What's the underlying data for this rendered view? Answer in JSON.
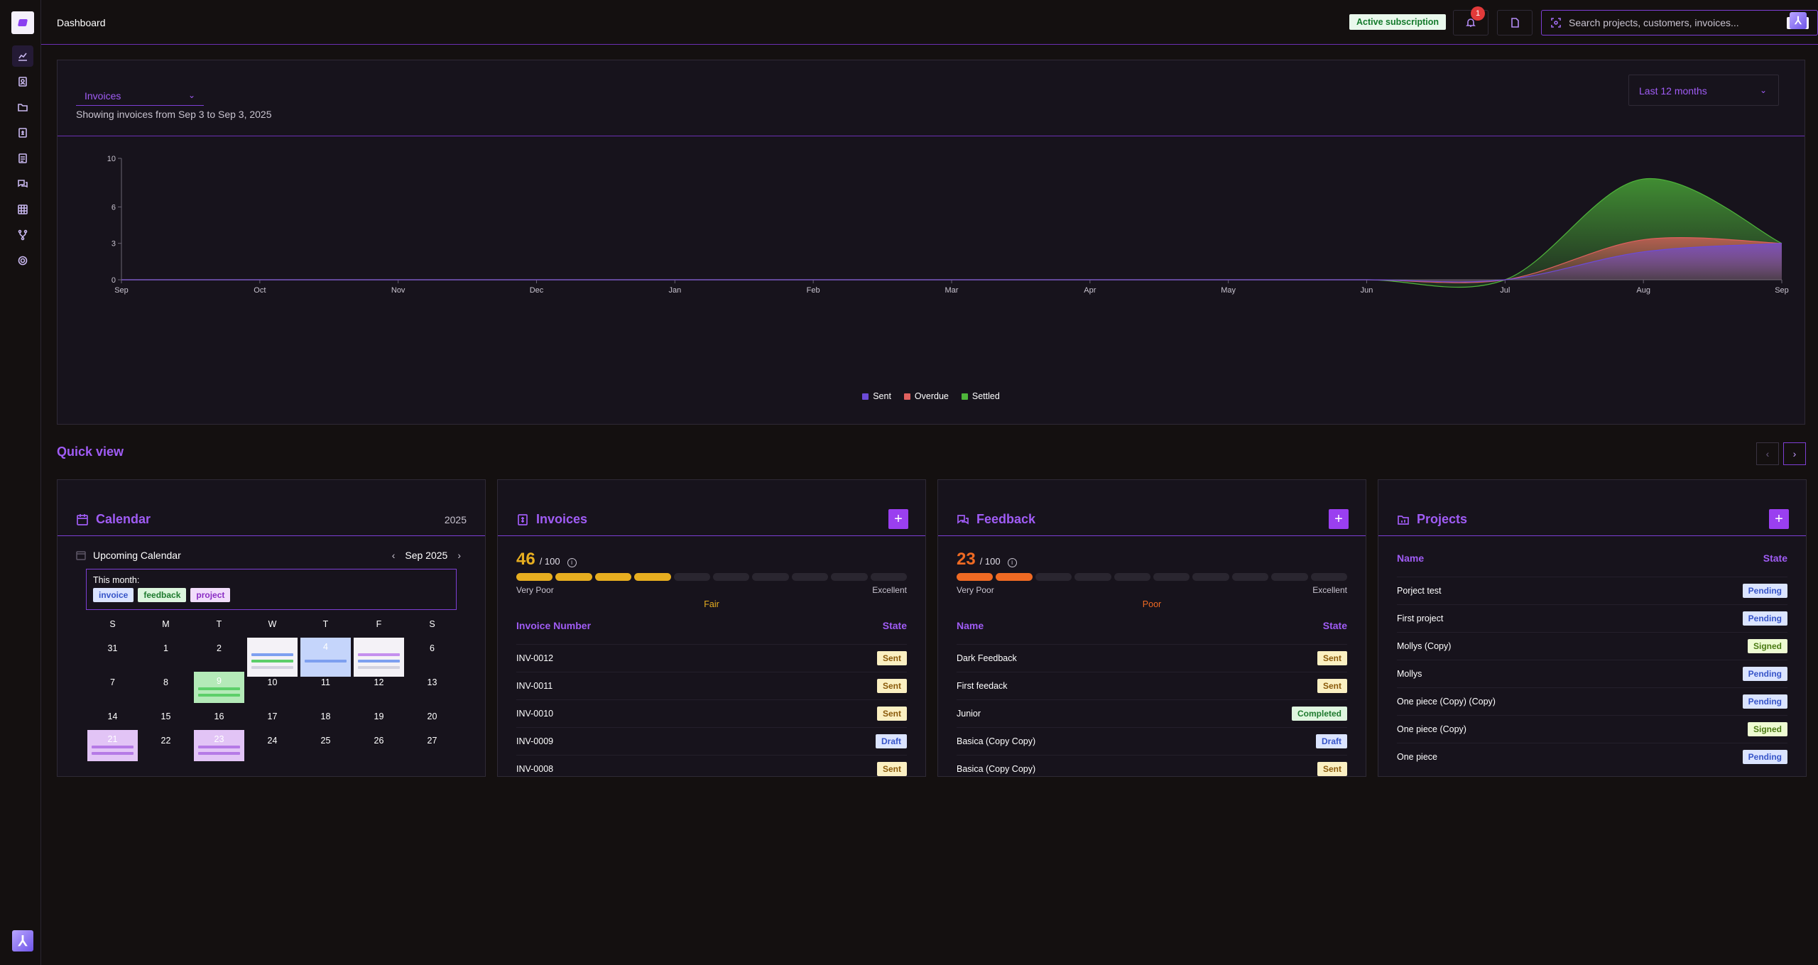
{
  "page": {
    "title": "Dashboard"
  },
  "topbar": {
    "subscription_label": "Active subscription",
    "notification_count": "1",
    "search_placeholder": "Search projects, customers, invoices...",
    "search_shortcut": "⌘K"
  },
  "sidebar": {
    "items": [
      {
        "name": "dashboard",
        "icon": "chart-icon",
        "active": true
      },
      {
        "name": "customers",
        "icon": "contacts-icon"
      },
      {
        "name": "projects",
        "icon": "folder-icon"
      },
      {
        "name": "invoices",
        "icon": "invoice-icon"
      },
      {
        "name": "documents",
        "icon": "document-icon"
      },
      {
        "name": "feedback",
        "icon": "chat-icon"
      },
      {
        "name": "calendar",
        "icon": "table-icon"
      },
      {
        "name": "workflows",
        "icon": "branch-icon"
      },
      {
        "name": "settings",
        "icon": "gear-icon"
      }
    ]
  },
  "chart_panel": {
    "type_select": "Invoices",
    "subtitle": "Showing invoices from Sep 3 to Sep 3, 2025",
    "range_select": "Last 12 months"
  },
  "chart_data": {
    "type": "area",
    "x": [
      "Sep",
      "Oct",
      "Nov",
      "Dec",
      "Jan",
      "Feb",
      "Mar",
      "Apr",
      "May",
      "Jun",
      "Jul",
      "Aug",
      "Sep"
    ],
    "yticks": [
      0,
      3,
      6,
      10
    ],
    "ylim": [
      0,
      10
    ],
    "series": [
      {
        "name": "Sent",
        "color": "#6c4bd8",
        "values": [
          0,
          0,
          0,
          0,
          0,
          0,
          0,
          0,
          0,
          0,
          0,
          2.3,
          3
        ]
      },
      {
        "name": "Overdue",
        "color": "#e0605e",
        "values": [
          0,
          0,
          0,
          0,
          0,
          0,
          0,
          0,
          0,
          0,
          0,
          3.3,
          3
        ]
      },
      {
        "name": "Settled",
        "color": "#4eb53a",
        "values": [
          0,
          0,
          0,
          0,
          0,
          0,
          0,
          0,
          0,
          0,
          0,
          8.3,
          3
        ]
      }
    ],
    "legend": "bottom-center",
    "grid": false
  },
  "quick_view": {
    "title": "Quick view",
    "prev_label": "‹",
    "next_label": "›"
  },
  "calendar": {
    "title": "Calendar",
    "year": "2025",
    "subtitle": "Upcoming Calendar",
    "month_label": "Sep 2025",
    "prev": "‹",
    "next": "›",
    "this_month_label": "This month:",
    "tags": [
      "invoice",
      "feedback",
      "project"
    ],
    "dow": [
      "S",
      "M",
      "T",
      "W",
      "T",
      "F",
      "S"
    ],
    "weeks": [
      [
        "31",
        "1",
        "2",
        "3",
        "4",
        "5",
        "6"
      ],
      [
        "7",
        "8",
        "9",
        "10",
        "11",
        "12",
        "13"
      ],
      [
        "14",
        "15",
        "16",
        "17",
        "18",
        "19",
        "20"
      ],
      [
        "21",
        "22",
        "23",
        "24",
        "25",
        "26",
        "27"
      ]
    ]
  },
  "invoices": {
    "title": "Invoices",
    "add_label": "+",
    "score": "46",
    "score_of": "/ 100",
    "score_word": "Fair",
    "score_color": "#e7ae20",
    "scale_low": "Very Poor",
    "scale_high": "Excellent",
    "filled_segments": 4,
    "columns": [
      "Invoice Number",
      "State"
    ],
    "rows": [
      {
        "name": "INV-0012",
        "state": "Sent"
      },
      {
        "name": "INV-0011",
        "state": "Sent"
      },
      {
        "name": "INV-0010",
        "state": "Sent"
      },
      {
        "name": "INV-0009",
        "state": "Draft"
      },
      {
        "name": "INV-0008",
        "state": "Sent"
      }
    ]
  },
  "feedback": {
    "title": "Feedback",
    "add_label": "+",
    "score": "23",
    "score_of": "/ 100",
    "score_word": "Poor",
    "score_color": "#ef6a23",
    "scale_low": "Very Poor",
    "scale_high": "Excellent",
    "filled_segments": 2,
    "columns": [
      "Name",
      "State"
    ],
    "rows": [
      {
        "name": "Dark Feedback",
        "state": "Sent"
      },
      {
        "name": "First feedack",
        "state": "Sent"
      },
      {
        "name": "Junior",
        "state": "Completed"
      },
      {
        "name": "Basica (Copy Copy)",
        "state": "Draft"
      },
      {
        "name": "Basica (Copy Copy)",
        "state": "Sent"
      }
    ]
  },
  "projects": {
    "title": "Projects",
    "add_label": "+",
    "columns": [
      "Name",
      "State"
    ],
    "rows": [
      {
        "name": "Porject test",
        "state": "Pending"
      },
      {
        "name": "First project",
        "state": "Pending"
      },
      {
        "name": "Mollys (Copy)",
        "state": "Signed"
      },
      {
        "name": "Mollys",
        "state": "Pending"
      },
      {
        "name": "One piece (Copy) (Copy)",
        "state": "Pending"
      },
      {
        "name": "One piece (Copy)",
        "state": "Signed"
      },
      {
        "name": "One piece",
        "state": "Pending"
      }
    ]
  }
}
